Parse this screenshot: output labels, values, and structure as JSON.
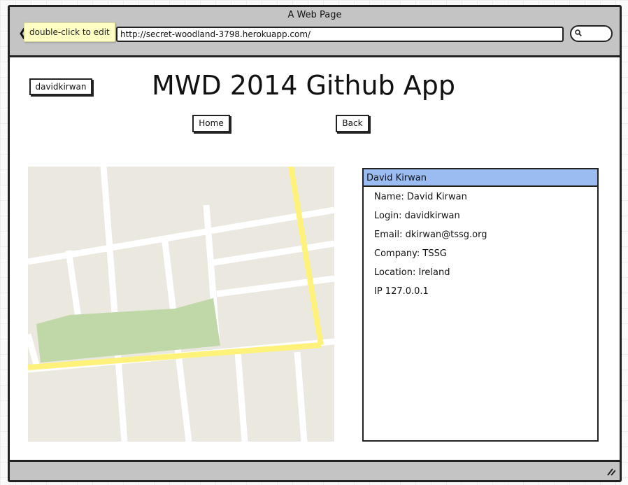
{
  "window": {
    "title": "A Web Page"
  },
  "browser": {
    "url": "http://secret-woodland-3798.herokuapp.com/",
    "tooltip": "double-click to edit"
  },
  "header": {
    "user_button_label": "davidkirwan",
    "title": "MWD 2014 Github App"
  },
  "nav": {
    "home_label": "Home",
    "back_label": "Back"
  },
  "profile": {
    "header": "David Kirwan",
    "lines": [
      "Name: David Kirwan",
      "Login: davidkirwan",
      "Email: dkirwan@tssg.org",
      "Company: TSSG",
      "Location: Ireland",
      "IP 127.0.0.1"
    ]
  },
  "colors": {
    "titlebar": "#c4c4c4",
    "panel_header": "#9bbcf1",
    "map_road_major": "#fff27a",
    "map_park": "#c0d8a8",
    "map_land": "#ebe8e0"
  },
  "icons": {
    "back": "back-arrow-icon",
    "search": "search-icon",
    "resize": "resize-grip-icon"
  }
}
